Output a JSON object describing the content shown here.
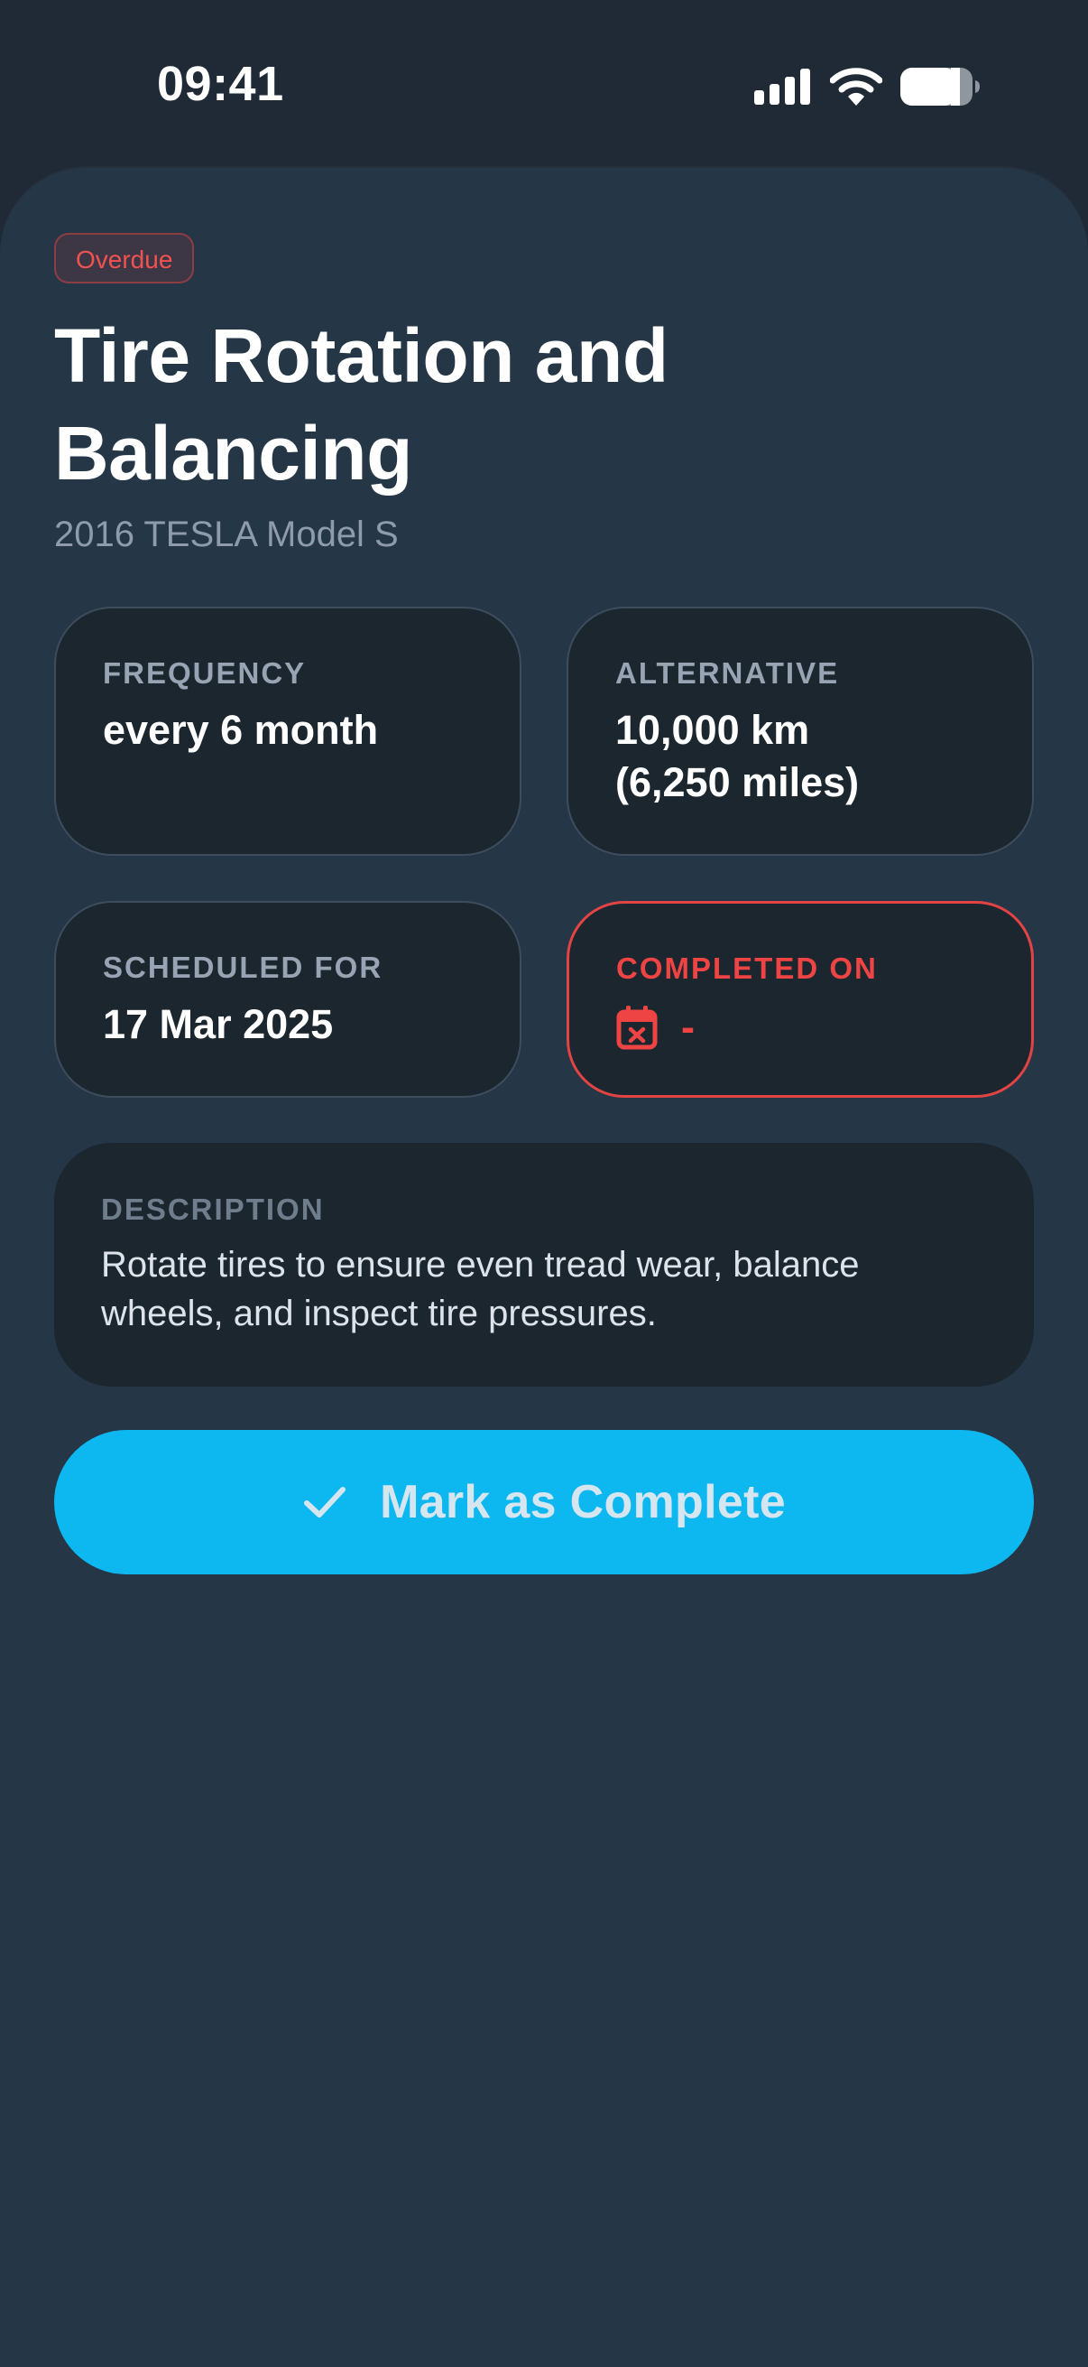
{
  "status_bar": {
    "time": "09:41",
    "icons": [
      "cellular-signal-icon",
      "wifi-icon",
      "battery-icon"
    ]
  },
  "task": {
    "status_badge": "Overdue",
    "title": "Tire Rotation and Balancing",
    "vehicle": "2016 TESLA Model S"
  },
  "details": {
    "frequency": {
      "label": "FREQUENCY",
      "value": "every 6 month"
    },
    "alternative": {
      "label": "ALTERNATIVE",
      "value_line1": "10,000 km",
      "value_line2": "(6,250 miles)"
    },
    "scheduled": {
      "label": "SCHEDULED FOR",
      "value": "17 Mar 2025"
    },
    "completed": {
      "label": "COMPLETED ON",
      "value": "-",
      "icon": "calendar-x-icon"
    }
  },
  "description": {
    "label": "DESCRIPTION",
    "text": "Rotate tires to ensure even tread wear, balance wheels, and inspect tire pressures."
  },
  "actions": {
    "complete_label": "Mark as Complete",
    "complete_icon": "check-icon"
  },
  "colors": {
    "background": "#1f2a36",
    "sheet": "#253646",
    "card": "#1c262e",
    "accent": "#0db7f0",
    "danger": "#ef4444"
  }
}
